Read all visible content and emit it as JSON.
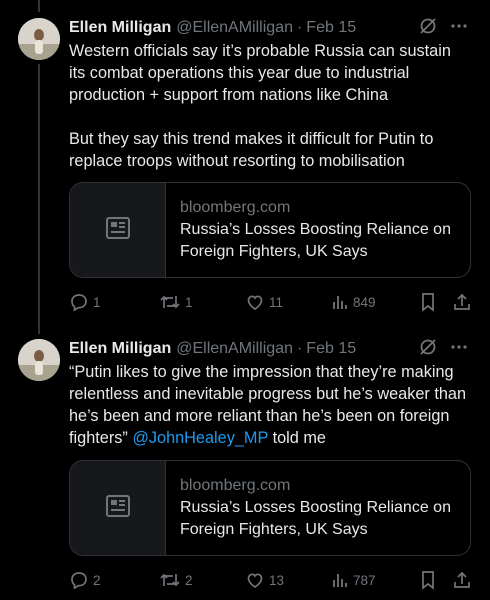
{
  "tweets": [
    {
      "author_name": "Ellen Milligan",
      "handle": "@EllenAMilligan",
      "separator": "·",
      "date": "Feb 15",
      "text_lines": [
        "Western officials say it’s probable Russia can sustain",
        "its combat operations this year due to industrial",
        "production + support from nations like China",
        "",
        "But they say this trend makes it difficult for Putin to",
        "replace troops without resorting to mobilisation"
      ],
      "card": {
        "domain": "bloomberg.com",
        "title_line1": "Russia’s Losses Boosting Reliance on",
        "title_line2": "Foreign Fighters, UK Says"
      },
      "actions": {
        "replies": "1",
        "reposts": "1",
        "likes": "11",
        "views": "849"
      }
    },
    {
      "author_name": "Ellen Milligan",
      "handle": "@EllenAMilligan",
      "separator": "·",
      "date": "Feb 15",
      "text_lines": [
        "“Putin likes to give the impression that they’re making",
        "relentless and inevitable progress but he’s weaker than",
        "he’s been and more reliant than he’s been on foreign"
      ],
      "text_last_prefix": "fighters” ",
      "mention": "@JohnHealey_MP",
      "text_last_suffix": " told me",
      "card": {
        "domain": "bloomberg.com",
        "title_line1": "Russia’s Losses Boosting Reliance on",
        "title_line2": "Foreign Fighters, UK Says"
      },
      "actions": {
        "replies": "2",
        "reposts": "2",
        "likes": "13",
        "views": "787"
      }
    }
  ],
  "icons": {
    "grok": "grok-icon",
    "more": "more-icon",
    "reply": "reply-icon",
    "repost": "repost-icon",
    "like": "like-icon",
    "views": "views-icon",
    "bookmark": "bookmark-icon",
    "share": "share-icon",
    "article": "article-icon"
  },
  "colors": {
    "background": "#000000",
    "text": "#e7e9ea",
    "muted": "#71767b",
    "link": "#1d9bf0",
    "border": "#2f3336"
  }
}
